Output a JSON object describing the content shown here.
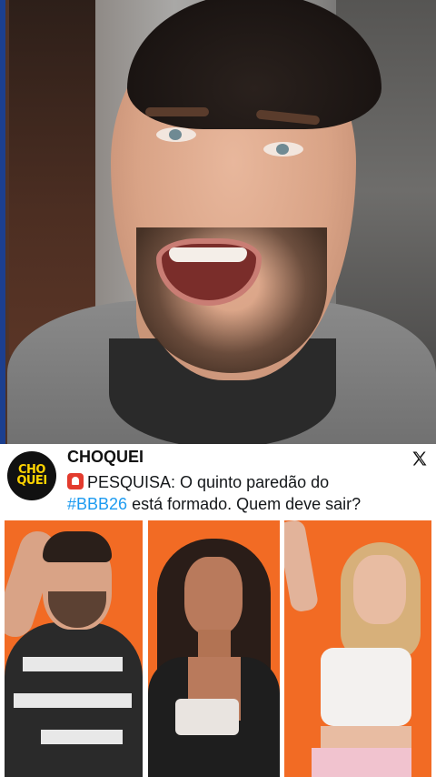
{
  "tweet": {
    "account_name": "CHOQUEI",
    "logo_line1": "CHO",
    "logo_line2": "QUEI",
    "text_before": "PESQUISA: O quinto paredão do",
    "hashtag": "#BBB26",
    "text_after": " está formado. Quem deve sair?",
    "siren_icon": "police-siren-emoji",
    "platform_icon": "x-logo-icon"
  },
  "photos": [
    {
      "subject": "contestant-1"
    },
    {
      "subject": "contestant-2"
    },
    {
      "subject": "contestant-3"
    }
  ],
  "colors": {
    "photo_background": "#f26b24",
    "logo_background": "#111111",
    "logo_text": "#ffd400",
    "hashtag": "#1d9bf0",
    "video_side_bar": "#1c3f8f"
  }
}
